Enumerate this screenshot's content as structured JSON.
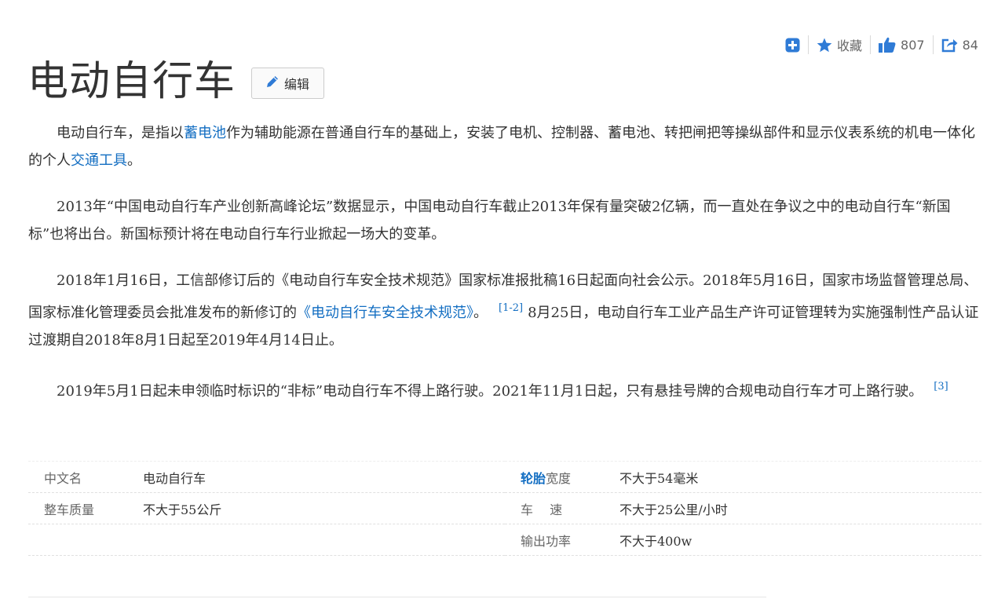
{
  "toolbar": {
    "favorite_label": "收藏",
    "like_count": "807",
    "share_count": "84",
    "accent_color": "#2f7bd6"
  },
  "page": {
    "title": "电动自行车",
    "edit_label": "编辑"
  },
  "paragraphs": {
    "p1": {
      "t1": "电动自行车，是指以",
      "link1": "蓄电池",
      "t2": "作为辅助能源在普通自行车的基础上，安装了电机、控制器、蓄电池、转把闸把等操纵部件和显示仪表系统的机电一体化的个人",
      "link2": "交通工具",
      "t3": "。"
    },
    "p2": {
      "text": "2013年“中国电动自行车产业创新高峰论坛”数据显示，中国电动自行车截止2013年保有量突破2亿辆，而一直处在争议之中的电动自行车“新国标”也将出台。新国标预计将在电动自行车行业掀起一场大的变革。"
    },
    "p3": {
      "t1": "2018年1月16日，工信部修订后的《电动自行车安全技术规范》国家标准报批稿16日起面向社会公示。2018年5月16日，国家市场监督管理总局、国家标准化管理委员会批准发布的新修订的",
      "link1": "《电动自行车安全技术规范》",
      "t2": "。",
      "ref": "[1-2]",
      "t3": "8月25日，电动自行车工业产品生产许可证管理转为实施强制性产品认证过渡期自2018年8月1日起至2019年4月14日止。"
    },
    "p4": {
      "t1": "2019年5月1日起未申领临时标识的“非标”电动自行车不得上路行驶。2021年11月1日起，只有悬挂号牌的合规电动自行车才可上路行驶。",
      "ref": "[3]"
    }
  },
  "basic_info": {
    "left": [
      {
        "name": "中文名",
        "value": "电动自行车"
      },
      {
        "name": "整车质量",
        "value": "不大于55公斤"
      }
    ],
    "right": [
      {
        "name_link": "轮胎",
        "name_rest": "宽度",
        "value": "不大于54毫米"
      },
      {
        "name": "车　 速",
        "value": "不大于25公里/小时"
      },
      {
        "name": "输出功率",
        "value": "不大于400w"
      }
    ]
  }
}
